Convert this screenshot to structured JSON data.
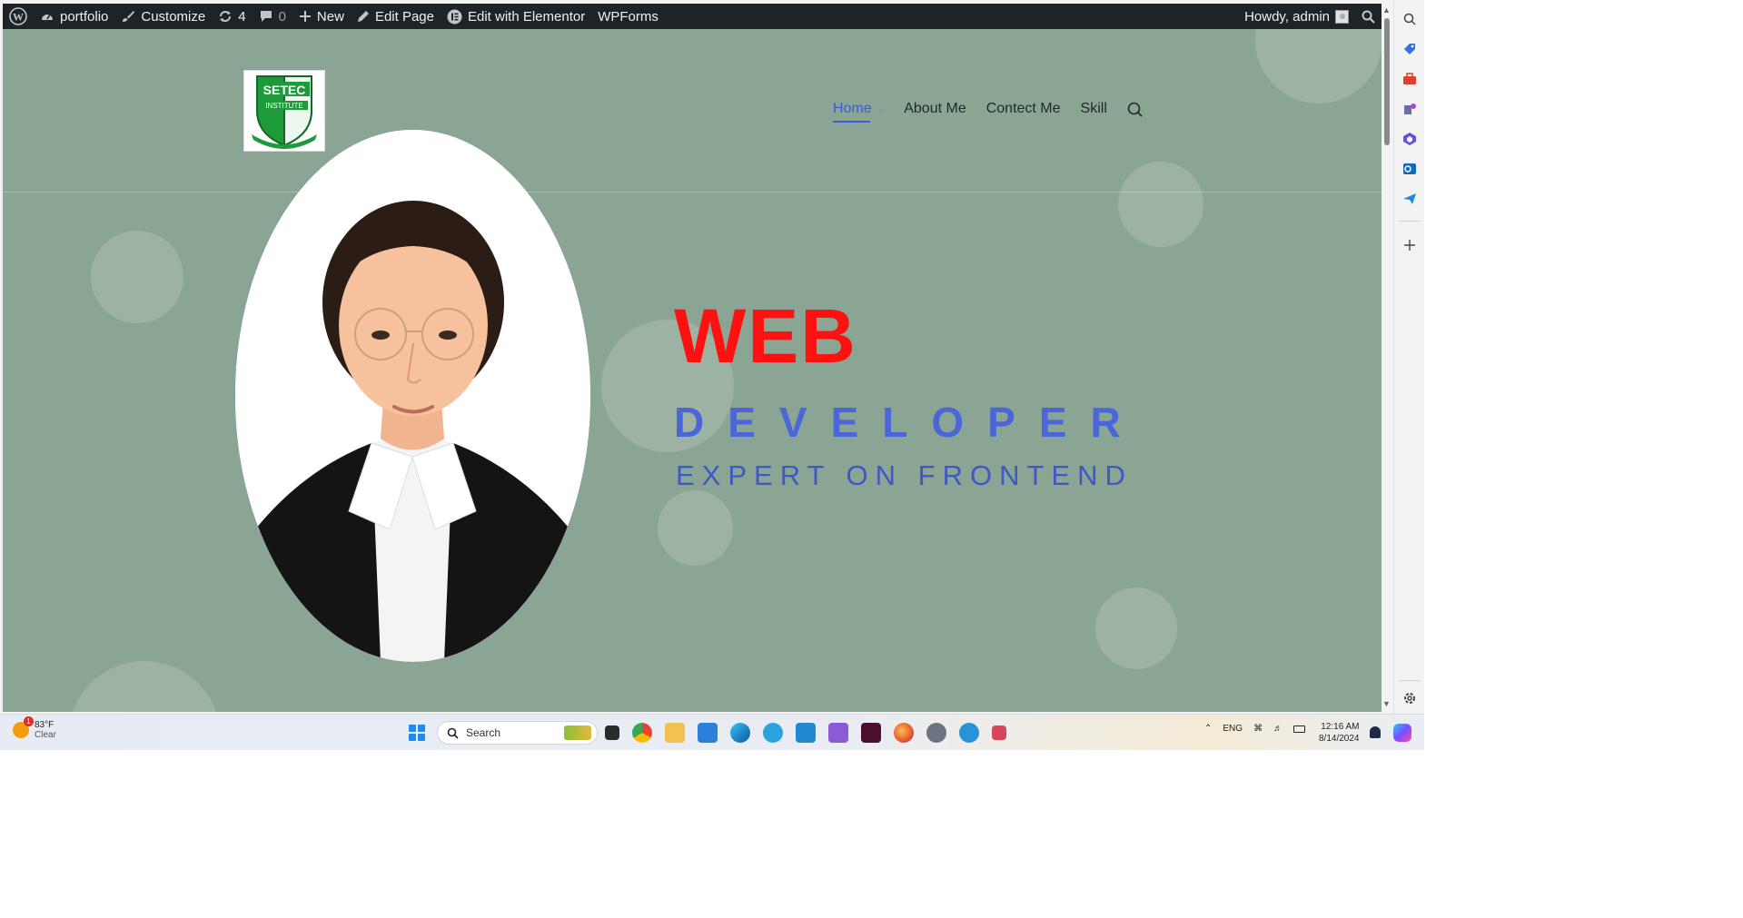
{
  "admin_bar": {
    "site_name": "portfolio",
    "customize": "Customize",
    "updates_count": "4",
    "comments_count": "0",
    "new": "New",
    "edit_page": "Edit Page",
    "edit_elementor": "Edit with Elementor",
    "wpforms": "WPForms",
    "greeting": "Howdy, admin"
  },
  "site": {
    "logo_text": "SETEC INSTITUTE",
    "nav": [
      {
        "label": "Home",
        "active": true
      },
      {
        "label": "About Me"
      },
      {
        "label": "Contect Me"
      },
      {
        "label": "Skill"
      }
    ]
  },
  "hero": {
    "title": "WEB",
    "subtitle": "DEVELOPER",
    "tagline": "EXPERT ON FRONTEND",
    "colors": {
      "title": "#ff1111",
      "subtitle": "#4a66d8",
      "background": "#8ba594"
    }
  },
  "taskbar": {
    "weather_temp": "83°F",
    "weather_desc": "Clear",
    "weather_badge": "1",
    "search_placeholder": "Search",
    "language": "ENG",
    "time": "12:16 AM",
    "date": "8/14/2024"
  }
}
